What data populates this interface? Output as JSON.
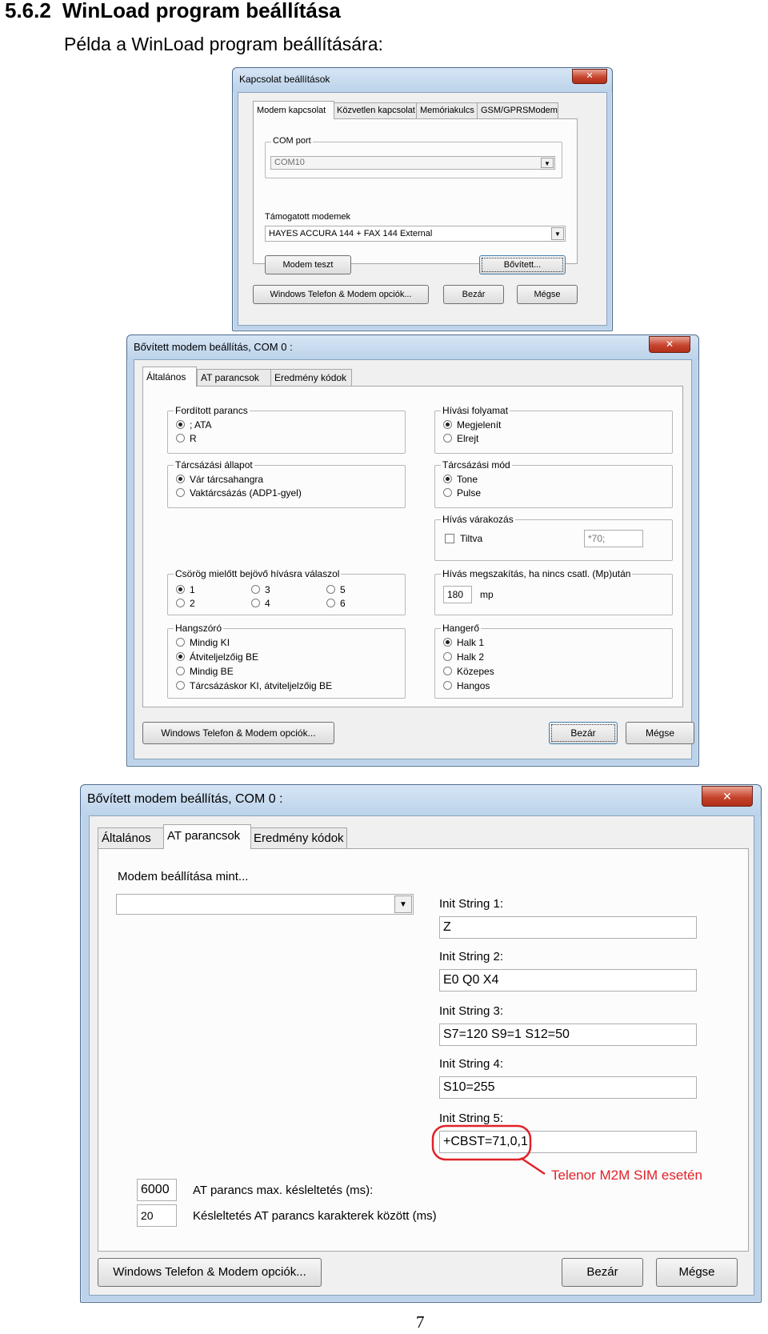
{
  "doc": {
    "section_number": "5.6.2",
    "section_title": "WinLoad program beállítása",
    "subtitle": "Példa a WinLoad program beállítására:",
    "page_number": "7"
  },
  "win1": {
    "title": "Kapcsolat beállítások",
    "close": "✕",
    "tabs": [
      "Modem kapcsolat",
      "Közvetlen kapcsolat",
      "Memóriakulcs",
      "GSM/GPRSModem"
    ],
    "com_port_legend": "COM port",
    "com_port_value": "COM10",
    "supported_label": "Támogatott modemek",
    "supported_value": "HAYES ACCURA 144 + FAX 144 External",
    "modem_test": "Modem teszt",
    "extended": "Bővített...",
    "win_tel": "Windows Telefon & Modem opciók...",
    "close_btn": "Bezár",
    "cancel_btn": "Mégse"
  },
  "win2": {
    "title": "Bővített modem beállítás, COM 0 :",
    "close": "✕",
    "tabs": [
      "Általános",
      "AT parancsok",
      "Eredmény kódok"
    ],
    "g_reversed": {
      "legend": "Fordított parancs",
      "opt1": "; ATA",
      "opt2": "R"
    },
    "g_callflow": {
      "legend": "Hívási folyamat",
      "opt1": "Megjelenít",
      "opt2": "Elrejt"
    },
    "g_dialstate": {
      "legend": "Tárcsázási állapot",
      "opt1": "Vár tárcsahangra",
      "opt2": "Vaktárcsázás (ADP1-gyel)"
    },
    "g_dialmode": {
      "legend": "Tárcsázási mód",
      "opt1": "Tone",
      "opt2": "Pulse"
    },
    "g_callwait": {
      "legend": "Hívás várakozás",
      "check": "Tiltva",
      "value": "*70;"
    },
    "g_rings": {
      "legend": "Csörög mielőtt bejövő hívásra válaszol",
      "opts": [
        "1",
        "3",
        "5",
        "2",
        "4",
        "6"
      ]
    },
    "g_hangup": {
      "legend": "Hívás megszakítás, ha nincs csatl. (Mp)után",
      "value": "180",
      "unit": "mp"
    },
    "g_speaker": {
      "legend": "Hangszóró",
      "opts": [
        "Mindig KI",
        "Átviteljelzőig BE",
        "Mindig BE",
        "Tárcsázáskor KI, átviteljelzőig BE"
      ]
    },
    "g_volume": {
      "legend": "Hangerő",
      "opts": [
        "Halk 1",
        "Halk 2",
        "Közepes",
        "Hangos"
      ]
    },
    "win_tel": "Windows Telefon & Modem opciók...",
    "close_btn": "Bezár",
    "cancel_btn": "Mégse"
  },
  "win3": {
    "title": "Bővített modem beállítás, COM 0 :",
    "close": "✕",
    "tabs": [
      "Általános",
      "AT parancsok",
      "Eredmény kódok"
    ],
    "modem_as": "Modem beállítása mint...",
    "modem_as_value": "",
    "init": [
      {
        "label": "Init String 1:",
        "value": "Z"
      },
      {
        "label": "Init String 2:",
        "value": "E0 Q0 X4"
      },
      {
        "label": "Init String 3:",
        "value": "S7=120 S9=1 S12=50"
      },
      {
        "label": "Init String 4:",
        "value": "S10=255"
      },
      {
        "label": "Init String 5:",
        "value": "+CBST=71,0,1"
      }
    ],
    "annotation": "Telenor M2M SIM esetén",
    "annotation_color": "#e0222a",
    "max_delay_value": "6000",
    "max_delay_label": "AT parancs max. késleltetés (ms):",
    "char_delay_value": "20",
    "char_delay_label": "Késleltetés AT parancs karakterek között (ms)",
    "win_tel": "Windows Telefon & Modem opciók...",
    "close_btn": "Bezár",
    "cancel_btn": "Mégse"
  }
}
